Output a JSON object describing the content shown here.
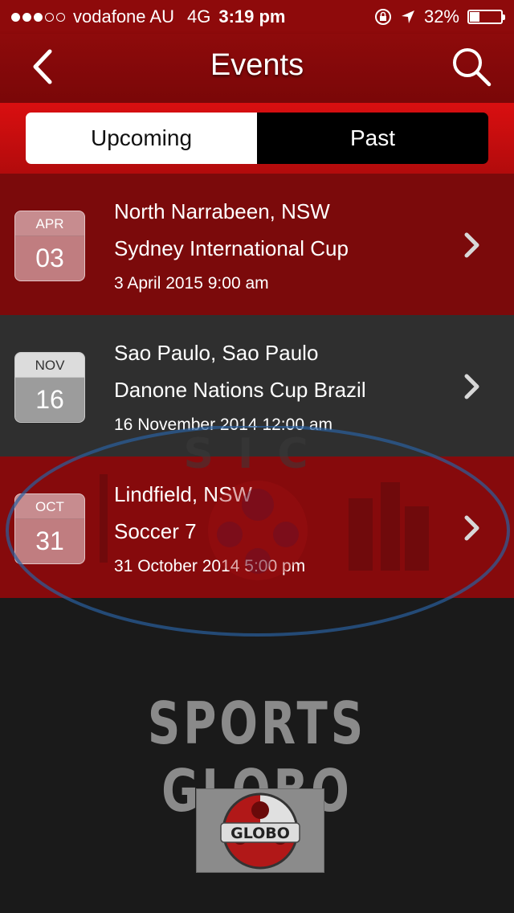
{
  "status": {
    "carrier": "vodafone AU",
    "network": "4G",
    "time": "3:19 pm",
    "battery_label": "32%",
    "battery_level": 0.32,
    "signal_bars_filled": 3,
    "signal_bars_total": 5
  },
  "nav": {
    "title": "Events",
    "back_icon": "chevron-left-icon",
    "search_icon": "search-icon"
  },
  "tabs": {
    "upcoming": "Upcoming",
    "past": "Past",
    "selected": "Upcoming"
  },
  "events": [
    {
      "month": "APR",
      "day": "03",
      "location": "North Narrabeen, NSW",
      "name": "Sydney International Cup",
      "datetime": "3 April 2015 9:00 am"
    },
    {
      "month": "NOV",
      "day": "16",
      "location": "Sao Paulo, Sao Paulo",
      "name": "Danone Nations Cup Brazil",
      "datetime": "16 November 2014 12:00 am"
    },
    {
      "month": "OCT",
      "day": "31",
      "location": "Lindfield, NSW",
      "name": "Soccer 7",
      "datetime": "31 October 2014 5:00 pm"
    }
  ],
  "footer": {
    "brand": "SPORTS GLOBO",
    "watermark_text": "SIC",
    "logo_text": "GLOBO"
  },
  "colors": {
    "header_red": "#8e0a0b",
    "segment_red": "#d90f10",
    "row_dark": "#2f2f2f"
  }
}
